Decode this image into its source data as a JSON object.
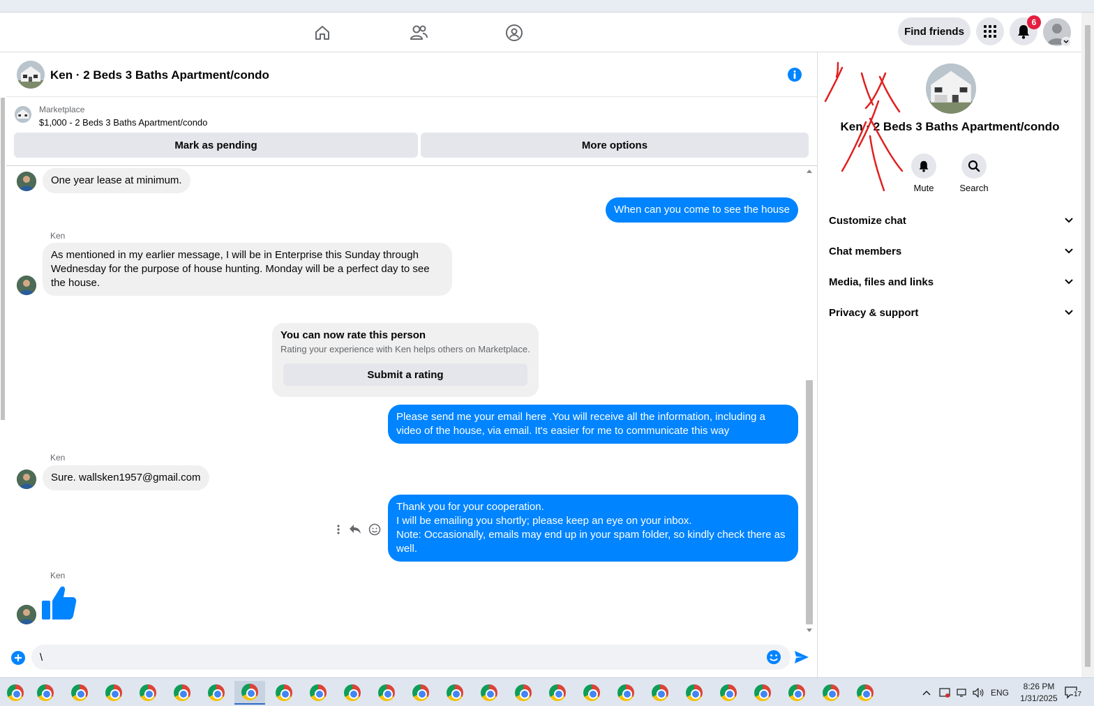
{
  "topnav": {
    "find_friends_label": "Find friends",
    "notification_count": "6"
  },
  "conversation": {
    "title": "Ken · 2 Beds 3 Baths Apartment/condo",
    "marketplace_label": "Marketplace",
    "listing": "$1,000 - 2 Beds 3 Baths Apartment/condo",
    "mark_pending_label": "Mark as pending",
    "more_options_label": "More options"
  },
  "messages": {
    "m1": "One year lease at minimum.",
    "m2": "When can you come to see the house",
    "sender": "Ken",
    "m3": "As mentioned in my earlier message, I will be in Enterprise this Sunday through Wednesday for the purpose of house hunting. Monday will be a perfect day to see the house.",
    "rate_title": "You can now rate this person",
    "rate_sub": "Rating your experience with Ken helps others on Marketplace.",
    "rate_button": "Submit a rating",
    "m4": "Please send me your email here .You will receive all the information, including a video of the house, via email. It's easier for me to communicate this way",
    "m5": "Sure. wallsken1957@gmail.com",
    "m6_line1": "Thank you for your cooperation.",
    "m6_line2": "I will be emailing you shortly; please keep an eye on your inbox.",
    "m6_line3": "Note: Occasionally, emails may end up in your spam folder, so kindly check there as well."
  },
  "composer": {
    "value": "\\"
  },
  "right_panel": {
    "title": "Ken · 2 Beds 3 Baths Apartment/condo",
    "mute_label": "Mute",
    "search_label": "Search",
    "sections": [
      "Customize chat",
      "Chat members",
      "Media, files and links",
      "Privacy & support"
    ]
  },
  "taskbar": {
    "language": "ENG",
    "time": "8:26 PM",
    "date": "1/31/2025",
    "notifications": "17"
  },
  "colors": {
    "accent": "#0084ff",
    "bubble_in": "#f0f0f0",
    "badge": "#e41e3f"
  }
}
